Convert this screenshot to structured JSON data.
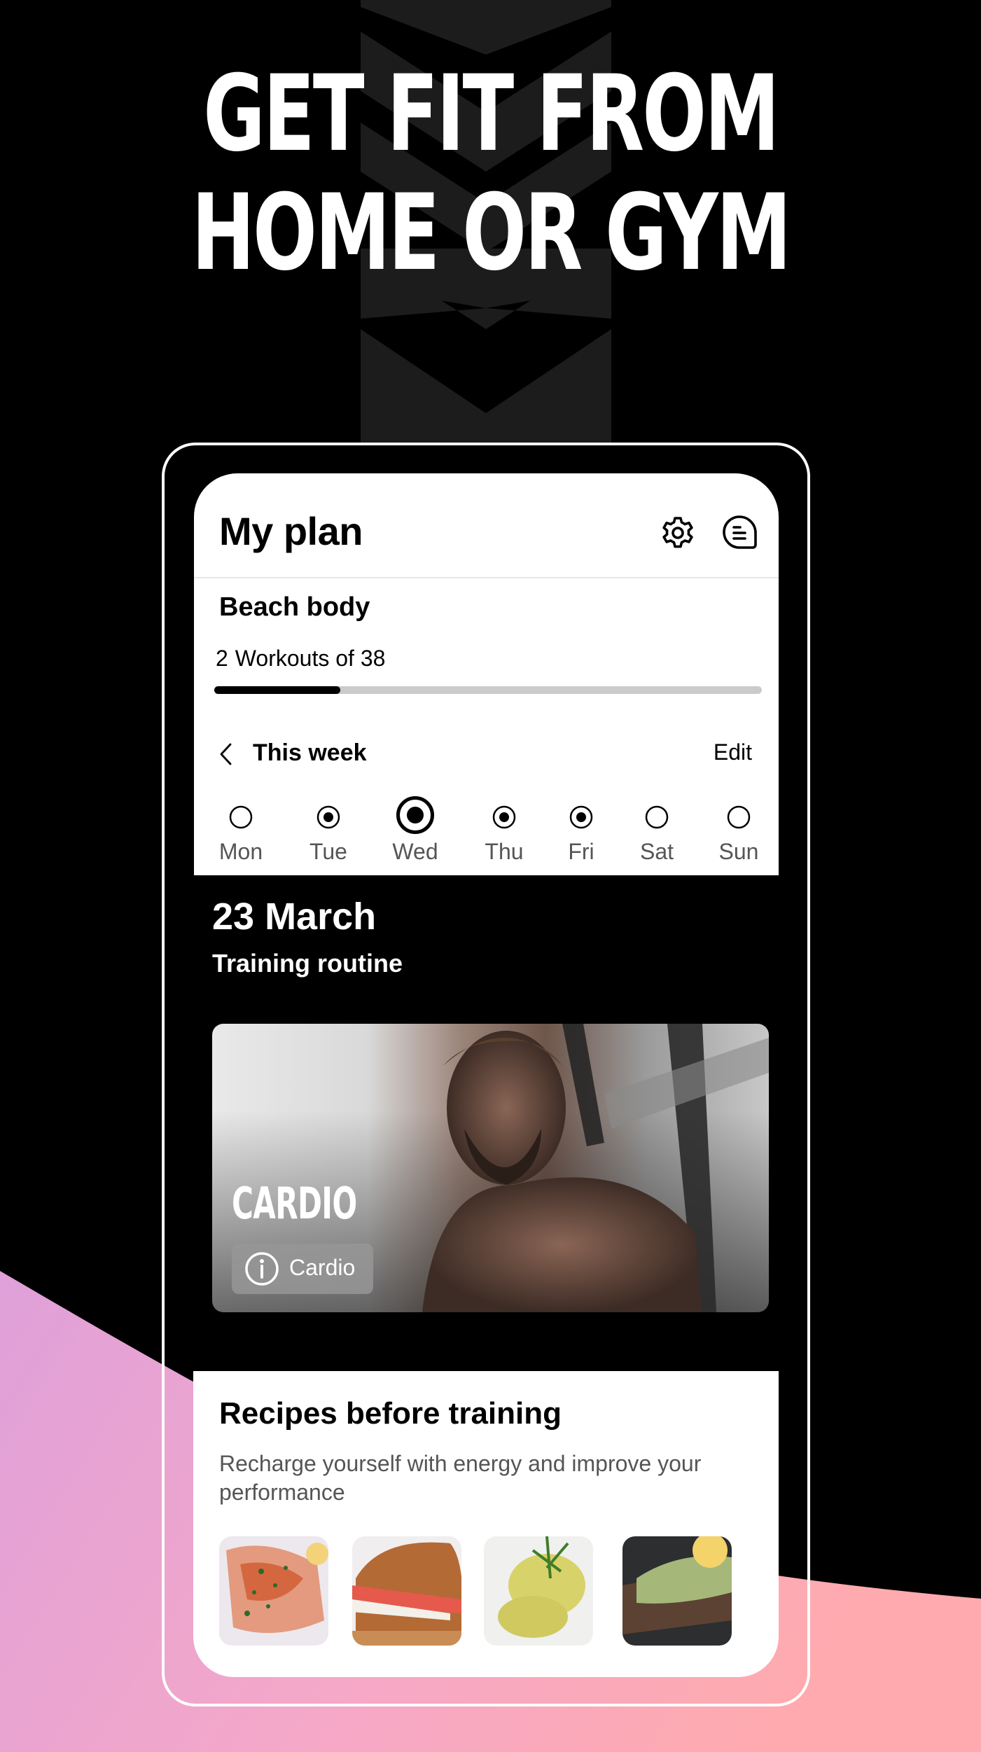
{
  "promo": {
    "headline_lines": [
      "GET FIT FROM",
      "HOME OR GYM"
    ]
  },
  "colors": {
    "background": "#000000",
    "chevron": "#1c1c1c",
    "pink_left": "#dfa0d9",
    "pink_right": "#ffaaae",
    "progress_fill": "#000000",
    "progress_track": "#cbcbcb"
  },
  "header": {
    "title": "My plan",
    "icons": [
      "gear-icon",
      "chat-menu-icon"
    ]
  },
  "plan": {
    "name": "Beach body",
    "completed_workouts": "2",
    "workouts_text": "Workouts of 38",
    "total_workouts": 38,
    "progress_fraction": 0.23
  },
  "week": {
    "label": "This week",
    "edit_label": "Edit",
    "days": [
      {
        "label": "Mon",
        "state": "empty"
      },
      {
        "label": "Tue",
        "state": "scheduled"
      },
      {
        "label": "Wed",
        "state": "today"
      },
      {
        "label": "Thu",
        "state": "scheduled"
      },
      {
        "label": "Fri",
        "state": "scheduled"
      },
      {
        "label": "Sat",
        "state": "empty"
      },
      {
        "label": "Sun",
        "state": "empty"
      }
    ]
  },
  "day_detail": {
    "date": "23 March",
    "section_title": "Training routine"
  },
  "workout": {
    "name": "CARDIO",
    "category": "Cardio",
    "category_icon": "info-icon"
  },
  "recipes": {
    "title": "Recipes before training",
    "description": "Recharge yourself with energy and improve your performance",
    "items": [
      {
        "name": "fish-with-herbs"
      },
      {
        "name": "wholegrain-sandwich"
      },
      {
        "name": "grilled-zucchini"
      },
      {
        "name": "avocado-toast"
      }
    ]
  }
}
